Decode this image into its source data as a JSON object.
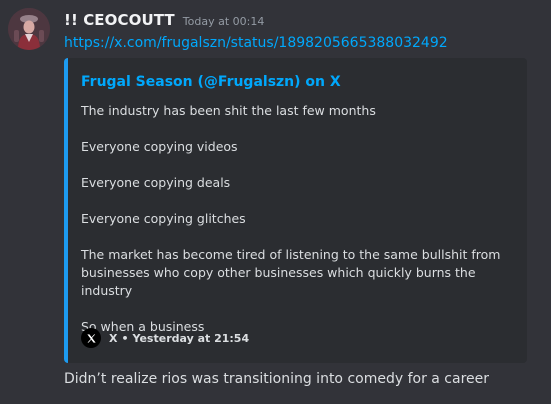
{
  "message": {
    "username": "!! CEOCOUTT",
    "timestamp": "Today at 00:14",
    "link": "https://x.com/frugalszn/status/1898205665388032492",
    "content": "Didn’t realize rios was transitioning into comedy for a career"
  },
  "embed": {
    "title": "Frugal Season (@Frugalszn) on X",
    "description": [
      "The industry has been shit the last few months",
      "Everyone copying videos",
      "Everyone copying deals",
      "Everyone copying glitches",
      "The market has become tired of listening to the same bullshit from businesses who copy other businesses which quickly burns the industry",
      "So when a business"
    ],
    "footer": {
      "icon": "x-logo-icon",
      "source": "X",
      "separator": "•",
      "time": "Yesterday at 21:54"
    },
    "accent_color": "#1d9bf0"
  },
  "colors": {
    "background": "#323339",
    "embed_background": "#2b2d31",
    "link": "#00a8fc"
  }
}
